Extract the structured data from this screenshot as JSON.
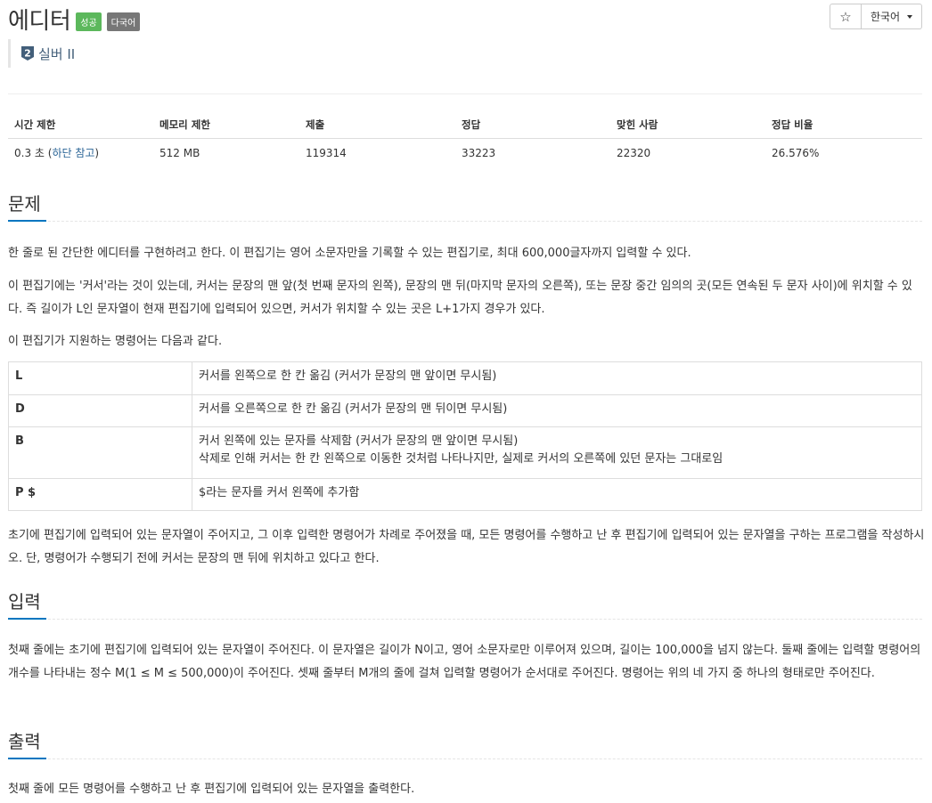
{
  "problem": {
    "title": "에디터",
    "labels": [
      "성공",
      "다국어"
    ],
    "tier": "실버 II"
  },
  "toolbar": {
    "star": "☆",
    "language": "한국어"
  },
  "info_table": {
    "headers": [
      "시간 제한",
      "메모리 제한",
      "제출",
      "정답",
      "맞힌 사람",
      "정답 비율"
    ],
    "values": {
      "time_value": "0.3 초 (",
      "time_link": "하단 참고",
      "time_close": ")",
      "memory": "512 MB",
      "submissions": "119314",
      "correct": "33223",
      "solvers": "22320",
      "ratio": "26.576%"
    }
  },
  "sections": {
    "problem_title": "문제",
    "problem_paragraphs": [
      "한 줄로 된 간단한 에디터를 구현하려고 한다. 이 편집기는 영어 소문자만을 기록할 수 있는 편집기로, 최대 600,000글자까지 입력할 수 있다.",
      "이 편집기에는 '커서'라는 것이 있는데, 커서는 문장의 맨 앞(첫 번째 문자의 왼쪽), 문장의 맨 뒤(마지막 문자의 오른쪽), 또는 문장 중간 임의의 곳(모든 연속된 두 문자 사이)에 위치할 수 있다. 즉 길이가 L인 문자열이 현재 편집기에 입력되어 있으면, 커서가 위치할 수 있는 곳은 L+1가지 경우가 있다.",
      "이 편집기가 지원하는 명령어는 다음과 같다."
    ],
    "commands": [
      {
        "key": "L",
        "desc": [
          "커서를 왼쪽으로 한 칸 옮김 (커서가 문장의 맨 앞이면 무시됨)"
        ]
      },
      {
        "key": "D",
        "desc": [
          "커서를 오른쪽으로 한 칸 옮김 (커서가 문장의 맨 뒤이면 무시됨)"
        ]
      },
      {
        "key": "B",
        "desc": [
          "커서 왼쪽에 있는 문자를 삭제함 (커서가 문장의 맨 앞이면 무시됨)",
          "삭제로 인해 커서는 한 칸 왼쪽으로 이동한 것처럼 나타나지만, 실제로 커서의 오른쪽에 있던 문자는 그대로임"
        ]
      },
      {
        "key": "P $",
        "desc": [
          "$라는 문자를 커서 왼쪽에 추가함"
        ]
      }
    ],
    "problem_after": "초기에 편집기에 입력되어 있는 문자열이 주어지고, 그 이후 입력한 명령어가 차례로 주어졌을 때, 모든 명령어를 수행하고 난 후 편집기에 입력되어 있는 문자열을 구하는 프로그램을 작성하시오. 단, 명령어가 수행되기 전에 커서는 문장의 맨 뒤에 위치하고 있다고 한다.",
    "input_title": "입력",
    "input_text": "첫째 줄에는 초기에 편집기에 입력되어 있는 문자열이 주어진다. 이 문자열은 길이가 N이고, 영어 소문자로만 이루어져 있으며, 길이는 100,000을 넘지 않는다. 둘째 줄에는 입력할 명령어의 개수를 나타내는 정수 M(1 ≤ M ≤ 500,000)이 주어진다. 셋째 줄부터 M개의 줄에 걸쳐 입력할 명령어가 순서대로 주어진다. 명령어는 위의 네 가지 중 하나의 형태로만 주어진다.",
    "output_title": "출력",
    "output_text": "첫째 줄에 모든 명령어를 수행하고 난 후 편집기에 입력되어 있는 문자열을 출력한다."
  },
  "colors": {
    "success_label": "#5cb85c",
    "lang_label": "#777777",
    "section_underline": "#0076c0",
    "tier": "#435f7a",
    "link": "#2a6496"
  }
}
